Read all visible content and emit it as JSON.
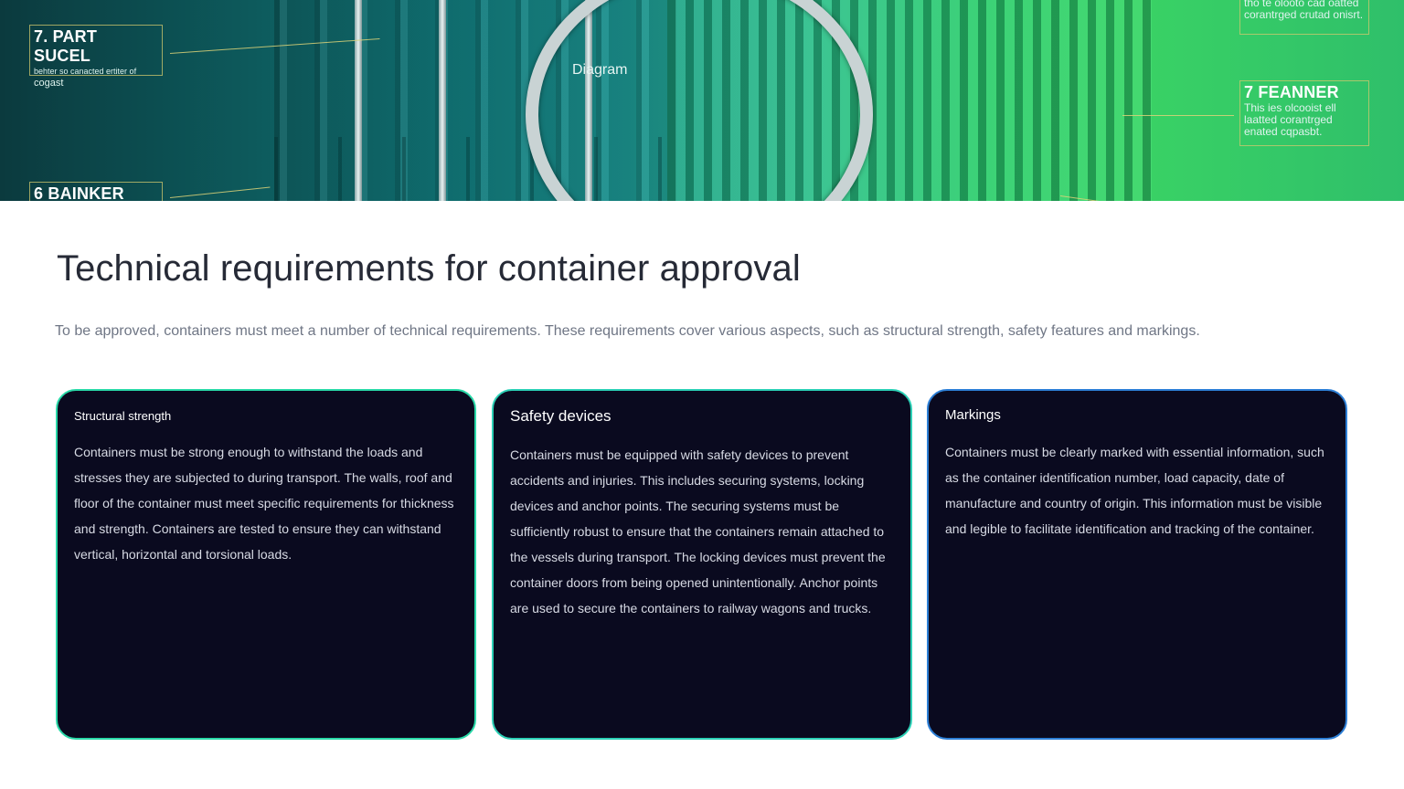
{
  "hero": {
    "diagram_label": "Diagram",
    "callouts": [
      {
        "head": "7.  PART SUCEL",
        "body": "behter so canacted ertiter of",
        "extra": "cogast"
      },
      {
        "head": "6     BAINKER",
        "body": ""
      },
      {
        "head": "",
        "body": "tho te olooto cad oatted corantrged crutad onisrt."
      },
      {
        "head": "7 FEANNER",
        "body": "This ies olcooist ell laatted corantrged enated cqpasbt."
      }
    ]
  },
  "title": "Technical requirements for container approval",
  "intro": "To be approved, containers must meet a number of technical requirements. These requirements cover various aspects, such as structural strength, safety features and markings.",
  "cards": [
    {
      "title": "Structural strength",
      "body": "Containers must be strong enough to withstand the loads and stresses they are subjected to during transport. The walls, roof and floor of the container must meet specific requirements for thickness and strength. Containers are tested to ensure they can withstand vertical, horizontal and torsional loads."
    },
    {
      "title": "Safety devices",
      "body": "Containers must be equipped with safety devices to prevent accidents and injuries. This includes securing systems, locking devices and anchor points. The securing systems must be sufficiently robust to ensure that the containers remain attached to the vessels during transport. The locking devices must prevent the container doors from being opened unintentionally. Anchor points are used to secure the containers to railway wagons and trucks."
    },
    {
      "title": "Markings",
      "body": "Containers must be clearly marked with essential information, such as the container identification number, load capacity, date of manufacture and country of origin. This information must be visible and legible to facilitate identification and tracking of the container."
    }
  ],
  "colors": {
    "card_bg": "#0a0a1f",
    "card1_border": "#2ad9a8",
    "card2_border": "#2cd0b6",
    "card3_border": "#2d7fd6",
    "title": "#262a36",
    "intro": "#6f7685"
  }
}
